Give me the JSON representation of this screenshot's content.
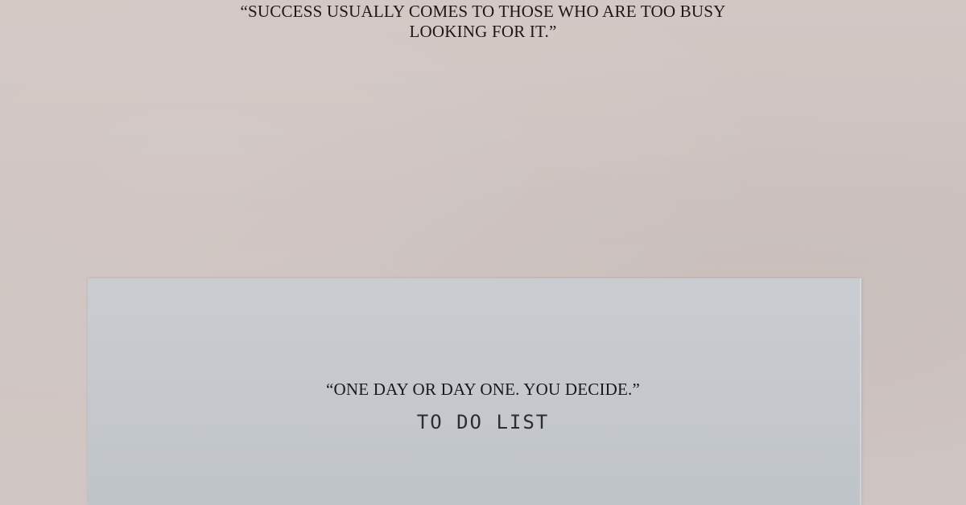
{
  "quote_top": {
    "line1": "“SUCCESS USUALLY COMES TO THOSE WHO ARE TOO BUSY",
    "line2": "LOOKING FOR IT.”"
  },
  "paper": {
    "quote": "“ONE DAY OR DAY ONE. YOU DECIDE.”",
    "stamp": "TO DO LIST"
  },
  "colors": {
    "wall": "#d0c6c3",
    "paper": "#c6cacf",
    "text": "#1d1719"
  }
}
